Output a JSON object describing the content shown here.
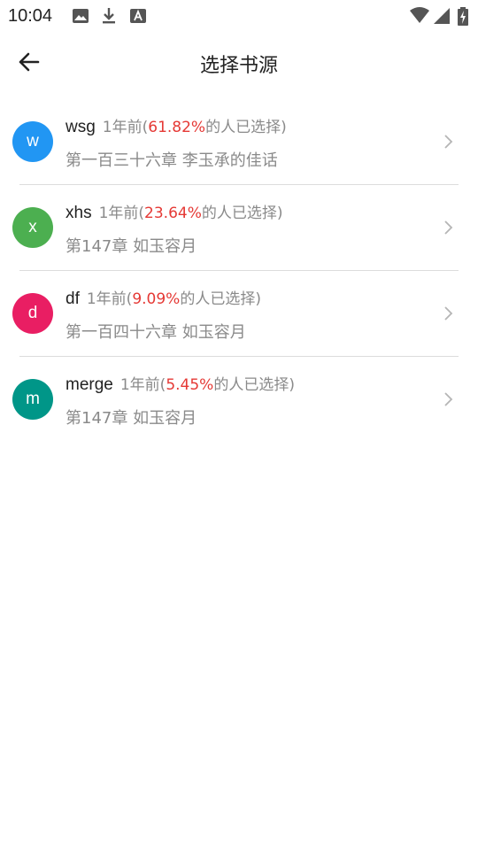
{
  "status_bar": {
    "time": "10:04",
    "left_icons": [
      "image-icon",
      "download-icon",
      "text-a-icon"
    ],
    "right_icons": [
      "wifi-icon",
      "signal-icon",
      "battery-icon"
    ]
  },
  "header": {
    "title": "选择书源",
    "back_icon": "arrow-left-icon"
  },
  "sources": [
    {
      "avatar_letter": "w",
      "avatar_color": "#2196F3",
      "name": "wsg",
      "meta_prefix": "1年前(",
      "percent": "61.82%",
      "meta_suffix": "的人已选择)",
      "chapter": "第一百三十六章 李玉承的佳话"
    },
    {
      "avatar_letter": "x",
      "avatar_color": "#4CAF50",
      "name": "xhs",
      "meta_prefix": "1年前(",
      "percent": "23.64%",
      "meta_suffix": "的人已选择)",
      "chapter": "第147章 如玉容月"
    },
    {
      "avatar_letter": "d",
      "avatar_color": "#E91E63",
      "name": "df",
      "meta_prefix": "1年前(",
      "percent": "9.09%",
      "meta_suffix": "的人已选择)",
      "chapter": "第一百四十六章 如玉容月"
    },
    {
      "avatar_letter": "m",
      "avatar_color": "#009688",
      "name": "merge",
      "meta_prefix": "1年前(",
      "percent": "5.45%",
      "meta_suffix": "的人已选择)",
      "chapter": "第147章 如玉容月"
    }
  ],
  "colors": {
    "accent_percent": "#e53935",
    "secondary_text": "#8a8a8a",
    "divider": "#dcdcdc"
  }
}
